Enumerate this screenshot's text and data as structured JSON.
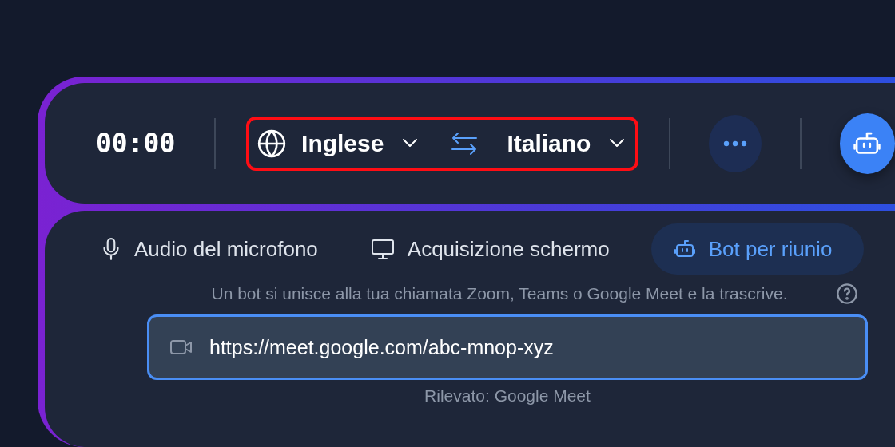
{
  "timer": "00:00",
  "language_pair": {
    "highlighted": true,
    "source": "Inglese",
    "target": "Italiano"
  },
  "tabs": [
    {
      "kind": "microphone",
      "label": "Audio del microfono",
      "selected": false
    },
    {
      "kind": "monitor",
      "label": "Acquisizione schermo",
      "selected": false
    },
    {
      "kind": "robot",
      "label": "Bot per riunio",
      "selected": true
    }
  ],
  "description": "Un bot si unisce alla tua chiamata Zoom, Teams o Google Meet e la trascrive.",
  "meeting_url": {
    "value": "https://meet.google.com/abc-mnop-xyz",
    "focused": true
  },
  "detected": "Rilevato: Google Meet"
}
